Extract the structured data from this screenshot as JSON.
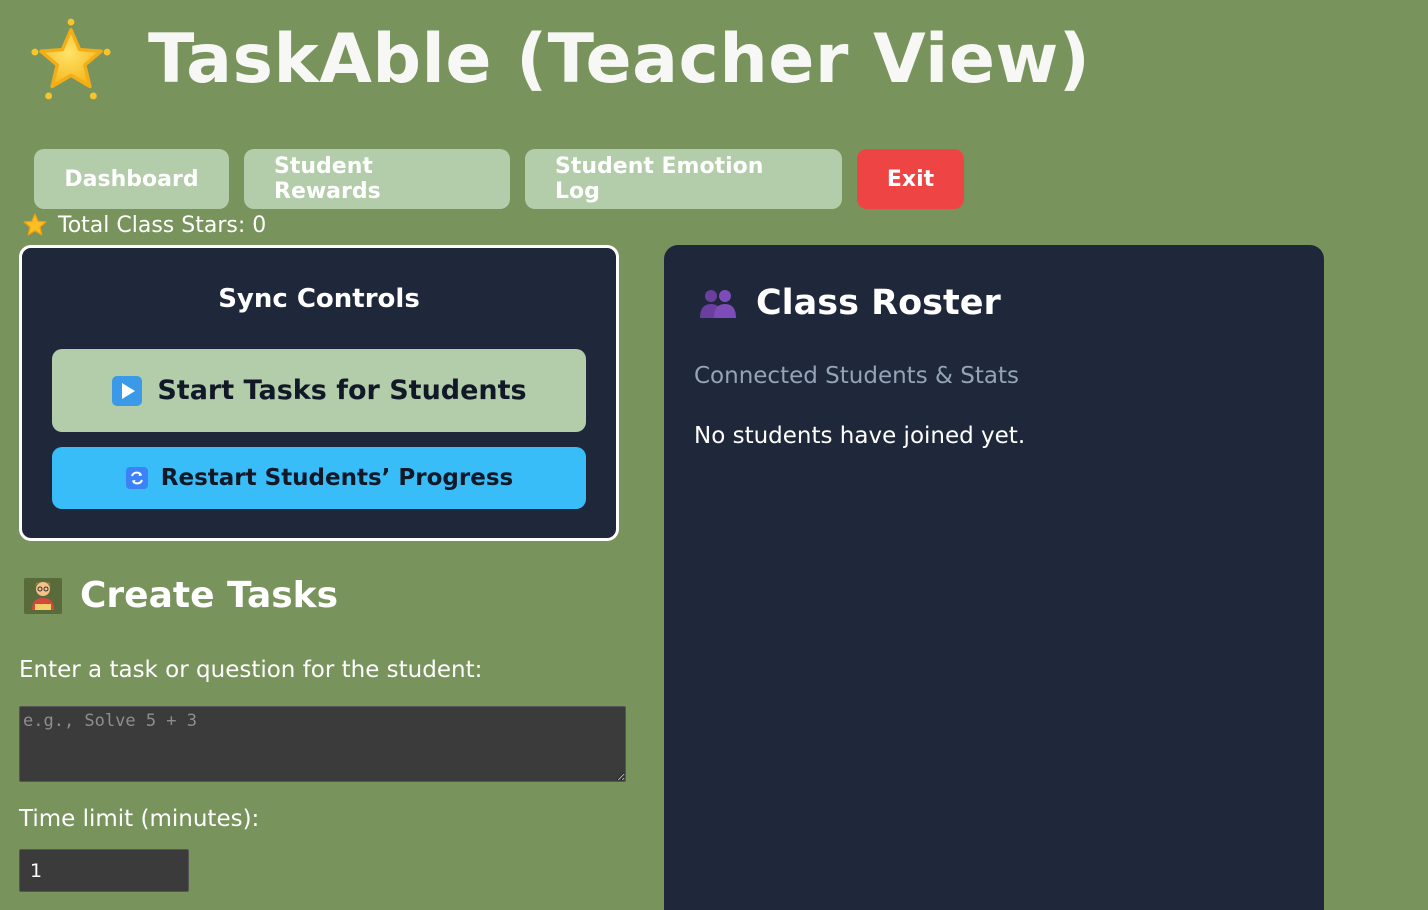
{
  "header": {
    "title": "TaskAble (Teacher View)",
    "logo_icon": "star-icon"
  },
  "nav": {
    "items": [
      {
        "label": "Dashboard"
      },
      {
        "label": "Student Rewards"
      },
      {
        "label": "Student Emotion Log"
      },
      {
        "label": "Exit"
      }
    ],
    "exit_color": "#ef4444",
    "button_color": "#b3cca9"
  },
  "stars": {
    "label": "Total Class Stars: 0",
    "icon": "star-icon"
  },
  "sync": {
    "title": "Sync Controls",
    "start_label": "Start Tasks for Students",
    "start_icon": "play-icon",
    "restart_label": "Restart Students’ Progress",
    "restart_icon": "refresh-icon",
    "restart_color": "#38bdf8"
  },
  "create": {
    "title": "Create Tasks",
    "icon": "teacher-icon",
    "task_label": "Enter a task or question for the student:",
    "task_placeholder": "e.g., Solve 5 + 3",
    "time_label": "Time limit (minutes):",
    "time_value": "1"
  },
  "roster": {
    "title": "Class Roster",
    "icon": "people-icon",
    "subtitle": "Connected Students & Stats",
    "empty_message": "No students have joined yet."
  },
  "colors": {
    "background": "#78935c",
    "panel": "#1f283a"
  }
}
